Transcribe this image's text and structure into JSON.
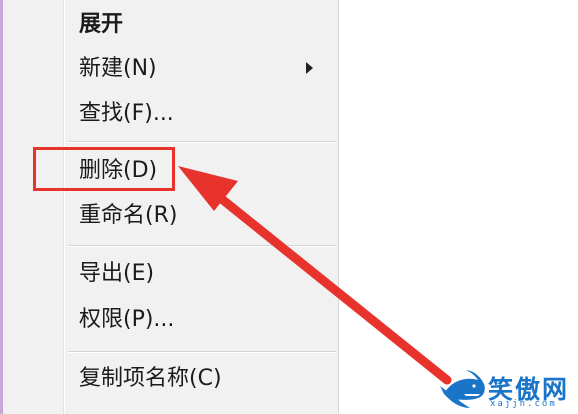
{
  "menu": {
    "items": [
      {
        "label": "展开"
      },
      {
        "label": "新建(N)"
      },
      {
        "label": "查找(F)..."
      },
      {
        "label": "删除(D)"
      },
      {
        "label": "重命名(R)"
      },
      {
        "label": "导出(E)"
      },
      {
        "label": "权限(P)..."
      },
      {
        "label": "复制项名称(C)"
      }
    ]
  },
  "annotation": {
    "color": "#e8322c"
  },
  "watermark": {
    "name": "笑傲网",
    "url": "xajjn.com"
  }
}
